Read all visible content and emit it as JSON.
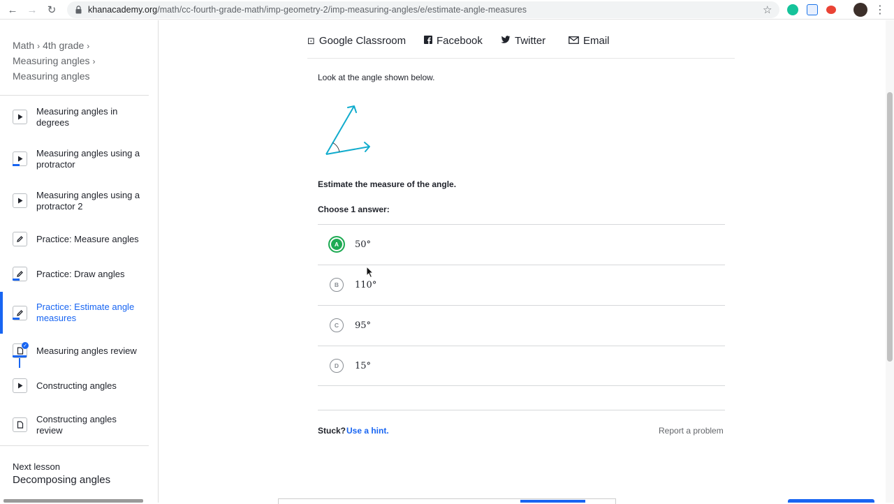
{
  "browser": {
    "url_host": "khanacademy.org",
    "url_path": "/math/cc-fourth-grade-math/imp-geometry-2/imp-measuring-angles/e/estimate-angle-measures"
  },
  "breadcrumb": {
    "items": [
      "Math",
      "4th grade",
      "Measuring angles",
      "Measuring angles"
    ],
    "separator": "›"
  },
  "lessons": [
    {
      "label": "Measuring angles in degrees",
      "icon": "play-icon"
    },
    {
      "label": "Measuring angles using a protractor",
      "icon": "play-icon"
    },
    {
      "label": "Measuring angles using a protractor 2",
      "icon": "play-icon"
    },
    {
      "label": "Practice: Measure angles",
      "icon": "pencil-icon"
    },
    {
      "label": "Practice: Draw angles",
      "icon": "pencil-icon"
    },
    {
      "label": "Practice: Estimate angle measures",
      "icon": "pencil-icon",
      "active": true
    },
    {
      "label": "Measuring angles review",
      "icon": "article-icon"
    },
    {
      "label": "Constructing angles",
      "icon": "play-icon"
    },
    {
      "label": "Constructing angles review",
      "icon": "article-icon"
    }
  ],
  "next_lesson": {
    "label": "Next lesson",
    "title": "Decomposing angles"
  },
  "share": {
    "google_classroom": "Google Classroom",
    "facebook": "Facebook",
    "twitter": "Twitter",
    "email": "Email"
  },
  "question": {
    "prompt": "Look at the angle shown below.",
    "instruction": "Estimate the measure of the angle.",
    "choose_label": "Choose 1 answer:",
    "choices": [
      {
        "letter": "A",
        "value": "50°",
        "selected": true
      },
      {
        "letter": "B",
        "value": "110°"
      },
      {
        "letter": "C",
        "value": "95°"
      },
      {
        "letter": "D",
        "value": "15°"
      }
    ]
  },
  "footer": {
    "stuck": "Stuck?",
    "hint": "Use a hint.",
    "report": "Report a problem"
  },
  "colors": {
    "accent": "#1865f2",
    "correct": "#1fab54",
    "figure": "#11accd"
  }
}
